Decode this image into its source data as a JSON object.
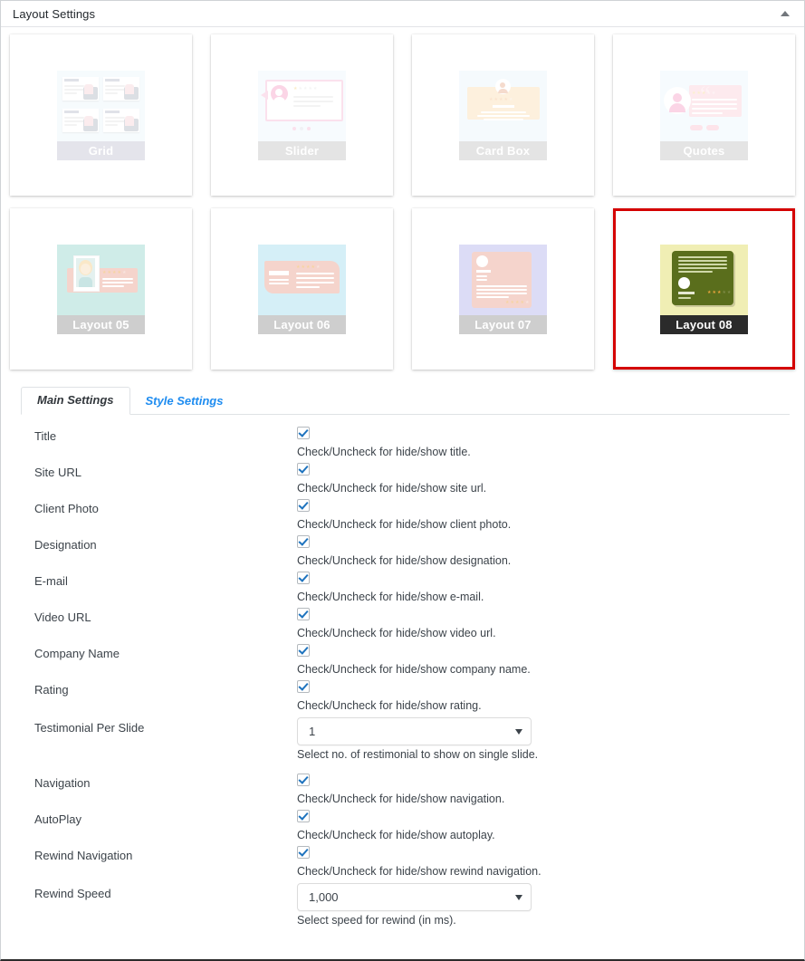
{
  "panel": {
    "title": "Layout Settings",
    "toggle_icon": "caret-up-icon"
  },
  "layouts": [
    {
      "id": "grid",
      "label": "Grid",
      "selected": false,
      "art_bg": "#e3f2fb",
      "label_bg": "#a9a8be"
    },
    {
      "id": "slider",
      "label": "Slider",
      "selected": false,
      "art_bg": "#e6f4fc",
      "label_bg": "#a7a7a7"
    },
    {
      "id": "card-box",
      "label": "Card Box",
      "selected": false,
      "art_bg": "#dff0fb",
      "label_bg": "#a7a7a7"
    },
    {
      "id": "quotes",
      "label": "Quotes",
      "selected": false,
      "art_bg": "#e2f4fc",
      "label_bg": "#a7a7a7"
    },
    {
      "id": "layout-05",
      "label": "Layout 05",
      "selected": false,
      "art_bg": "#a8ddd7",
      "label_bg": "#a7a7a7"
    },
    {
      "id": "layout-06",
      "label": "Layout 06",
      "selected": false,
      "art_bg": "#b3e3f2",
      "label_bg": "#a7a7a7"
    },
    {
      "id": "layout-07",
      "label": "Layout 07",
      "selected": false,
      "art_bg": "#c0c0f0",
      "label_bg": "#a7a7a7"
    },
    {
      "id": "layout-08",
      "label": "Layout 08",
      "selected": true,
      "art_bg": "#f0eeb4",
      "label_bg": "#2b2b2b"
    }
  ],
  "selection": {
    "selected_layout": "Layout 08",
    "highlight_color": "#d40000"
  },
  "tabs": [
    {
      "label": "Main Settings",
      "active": true
    },
    {
      "label": "Style Settings",
      "active": false
    }
  ],
  "settings": [
    {
      "label": "Title",
      "type": "checkbox",
      "checked": true,
      "hint": "Check/Uncheck for hide/show title."
    },
    {
      "label": "Site URL",
      "type": "checkbox",
      "checked": true,
      "hint": "Check/Uncheck for hide/show site url."
    },
    {
      "label": "Client Photo",
      "type": "checkbox",
      "checked": true,
      "hint": "Check/Uncheck for hide/show client photo."
    },
    {
      "label": "Designation",
      "type": "checkbox",
      "checked": true,
      "hint": "Check/Uncheck for hide/show designation."
    },
    {
      "label": "E-mail",
      "type": "checkbox",
      "checked": true,
      "hint": "Check/Uncheck for hide/show e-mail."
    },
    {
      "label": "Video URL",
      "type": "checkbox",
      "checked": true,
      "hint": "Check/Uncheck for hide/show video url."
    },
    {
      "label": "Company Name",
      "type": "checkbox",
      "checked": true,
      "hint": "Check/Uncheck for hide/show company name."
    },
    {
      "label": "Rating",
      "type": "checkbox",
      "checked": true,
      "hint": "Check/Uncheck for hide/show rating."
    },
    {
      "label": "Testimonial Per Slide",
      "type": "select",
      "value": "1",
      "hint": "Select no. of restimonial to show on single slide."
    },
    {
      "label": "Navigation",
      "type": "checkbox",
      "checked": true,
      "hint": "Check/Uncheck for hide/show navigation."
    },
    {
      "label": "AutoPlay",
      "type": "checkbox",
      "checked": true,
      "hint": "Check/Uncheck for hide/show autoplay."
    },
    {
      "label": "Rewind Navigation",
      "type": "checkbox",
      "checked": true,
      "hint": "Check/Uncheck for hide/show rewind navigation."
    },
    {
      "label": "Rewind Speed",
      "type": "select",
      "value": "1,000",
      "hint": "Select speed for rewind (in ms)."
    }
  ]
}
